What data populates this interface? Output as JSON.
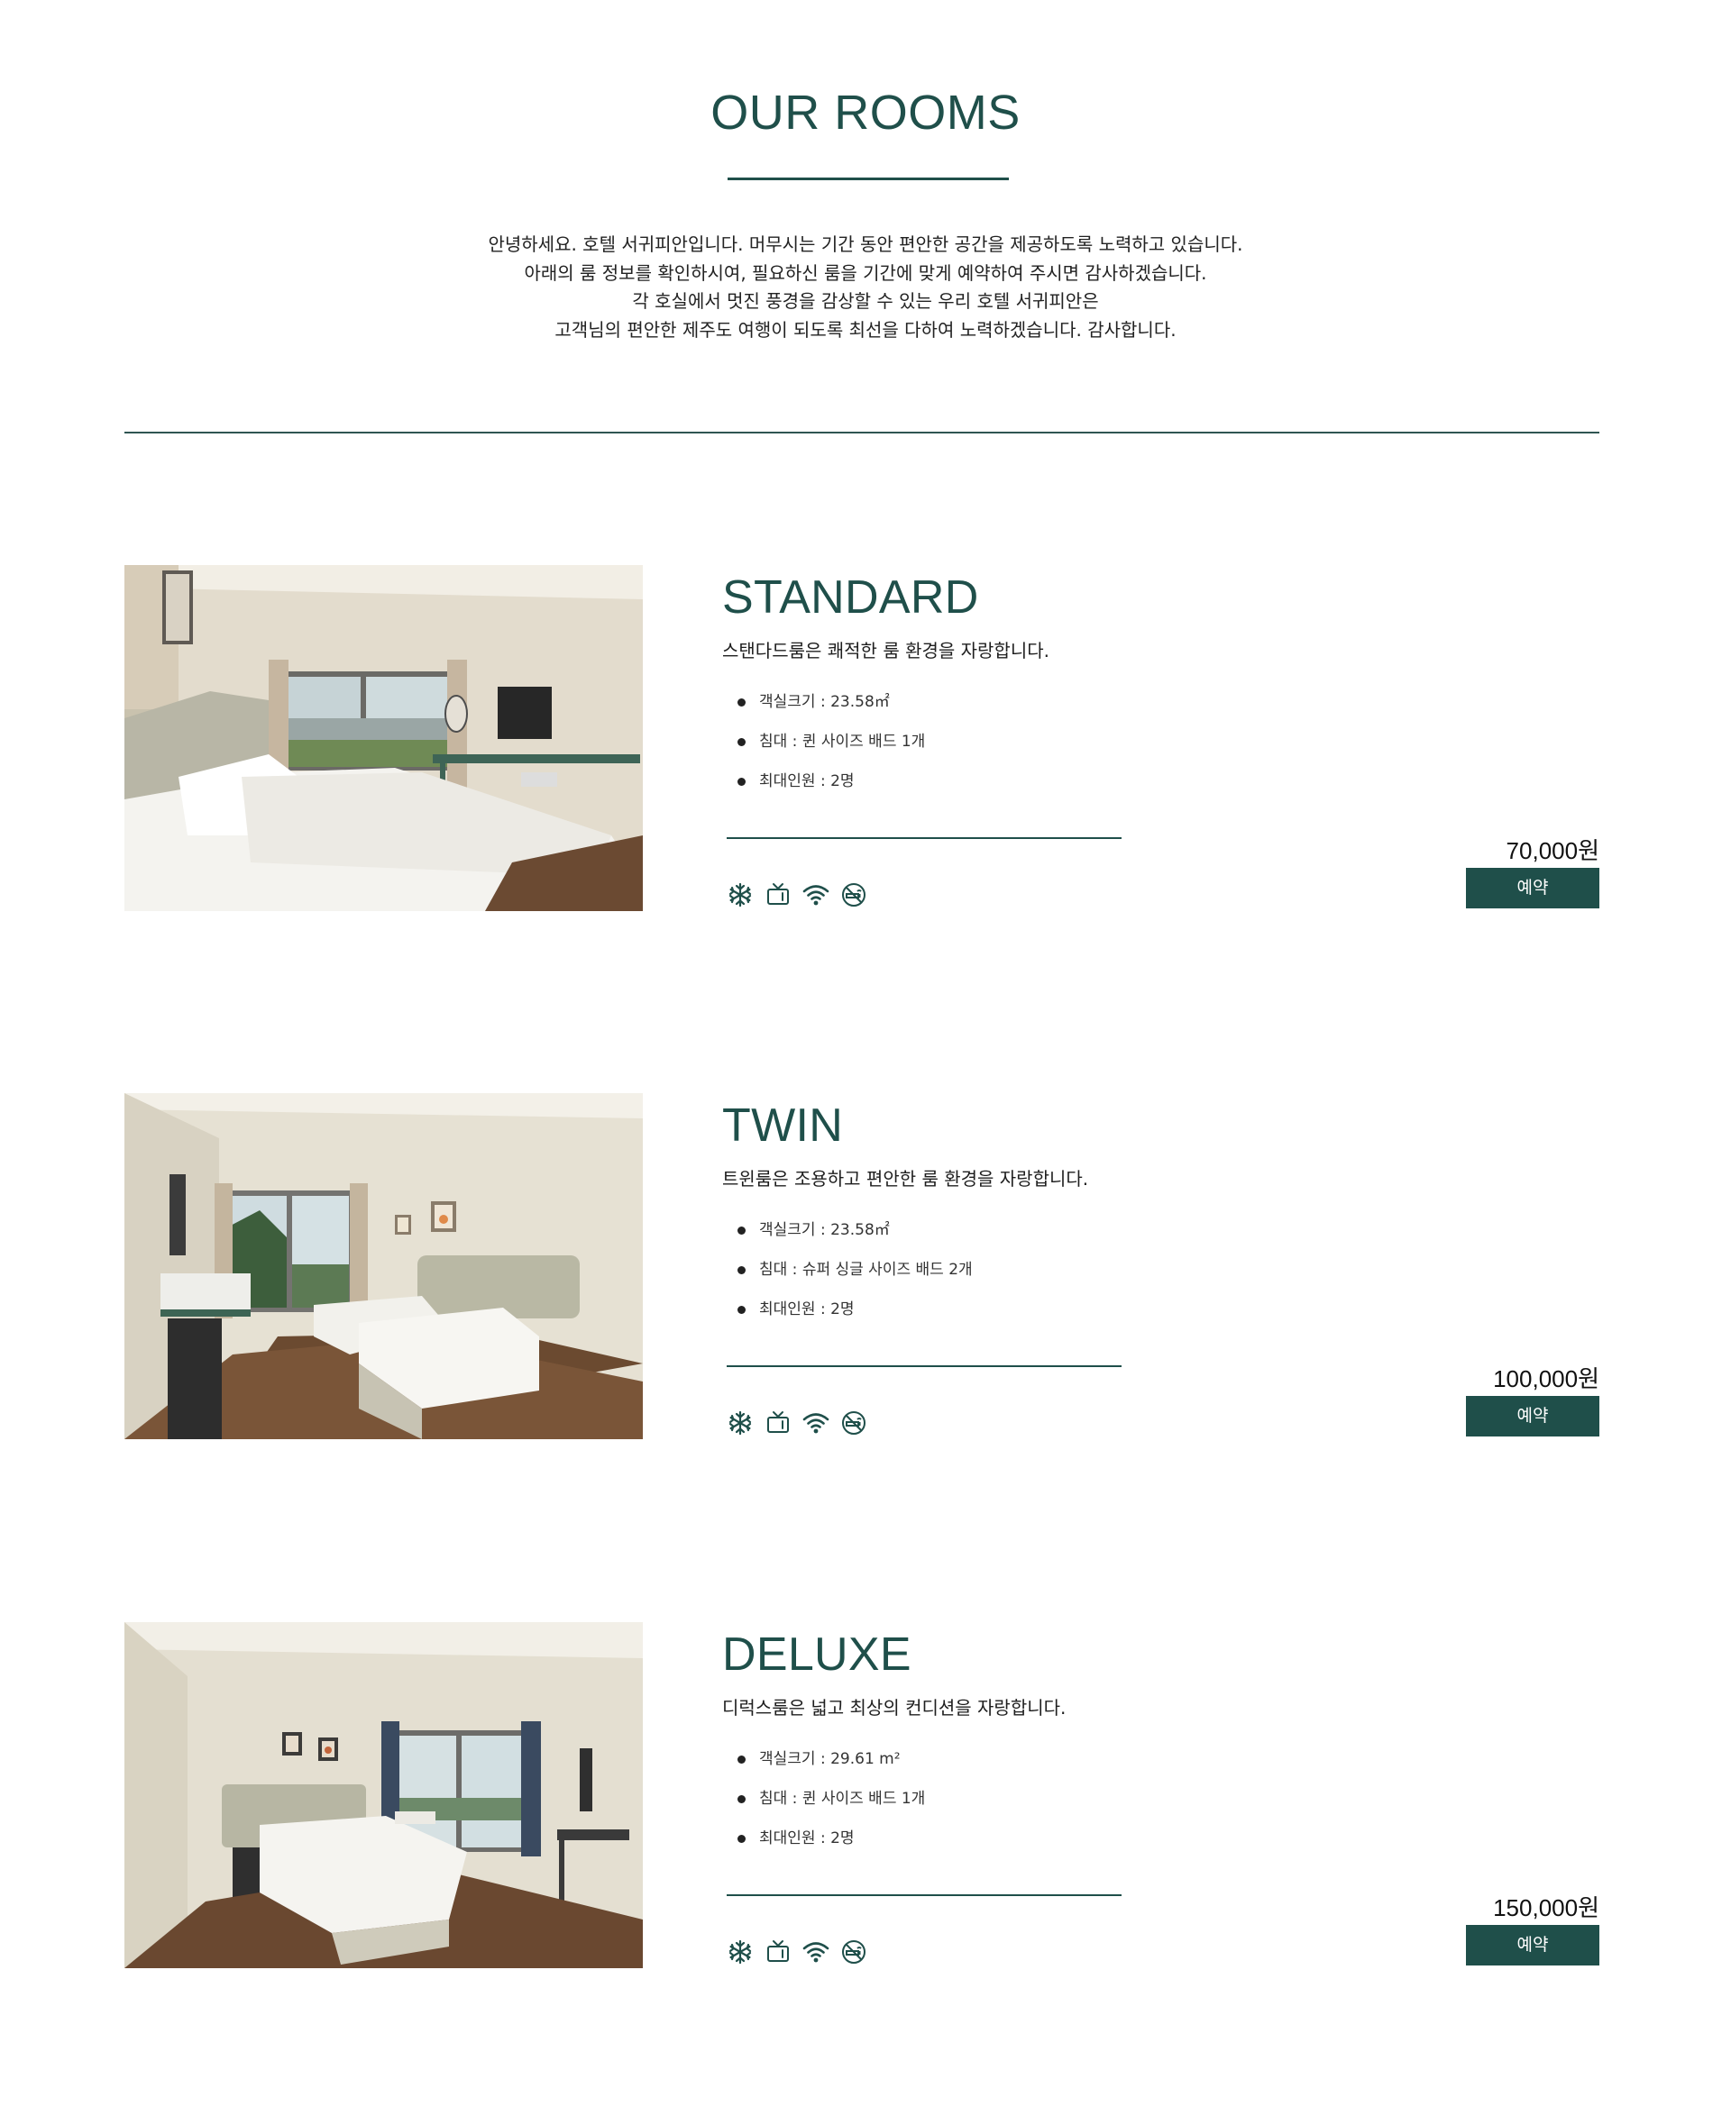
{
  "header": {
    "title": "OUR ROOMS",
    "intro_lines": [
      "안녕하세요. 호텔 서귀피안입니다.  머무시는 기간 동안 편안한 공간을 제공하도록 노력하고 있습니다.",
      "아래의 룸 정보를 확인하시여, 필요하신 룸을 기간에 맞게 예약하여 주시면 감사하겠습니다.",
      "각 호실에서 멋진 풍경을 감상할 수 있는 우리 호텔 서귀피안은",
      "고객님의 편안한 제주도 여행이 되도록 최선을 다하여 노력하겠습니다. 감사합니다."
    ]
  },
  "colors": {
    "accent": "#1f4f4a",
    "button_text": "#ffffff"
  },
  "amenity_icons": [
    "snowflake-icon",
    "tv-icon",
    "wifi-icon",
    "no-smoking-icon"
  ],
  "rooms": [
    {
      "name": "STANDARD",
      "description": "스탠다드룸은 쾌적한 룸 환경을 자랑합니다.",
      "specs": [
        "객실크기 : 23.58㎡",
        "침대 : 퀸 사이즈 배드 1개",
        "최대인원 : 2명"
      ],
      "price": "70,000원",
      "button_label": "예약"
    },
    {
      "name": "TWIN",
      "description": "트윈룸은 조용하고 편안한 룸 환경을 자랑합니다.",
      "specs": [
        "객실크기 : 23.58㎡",
        "침대 : 슈퍼 싱글 사이즈 배드 2개",
        "최대인원 : 2명"
      ],
      "price": "100,000원",
      "button_label": "예약"
    },
    {
      "name": "DELUXE",
      "description": "디럭스룸은 넓고 최상의 컨디션을 자랑합니다.",
      "specs": [
        "객실크기 : 29.61 m²",
        "침대 : 퀸 사이즈 배드 1개",
        "최대인원 : 2명"
      ],
      "price": "150,000원",
      "button_label": "예약"
    }
  ]
}
